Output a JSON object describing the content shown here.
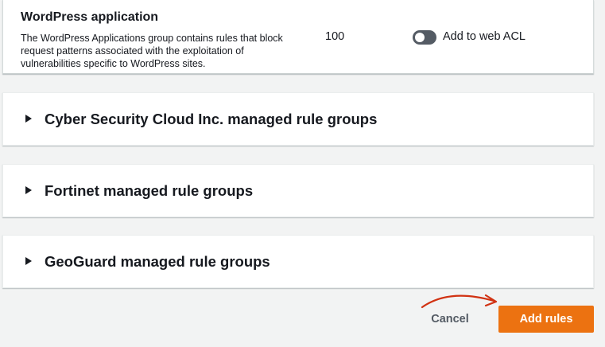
{
  "rule": {
    "name": "WordPress application",
    "description": "The WordPress Applications group contains rules that block request patterns associated with the exploitation of vulnerabilities specific to WordPress sites.",
    "capacity": "100",
    "toggle_label": "Add to web ACL",
    "toggle_on": false
  },
  "groups": [
    {
      "title": "Cyber Security Cloud Inc. managed rule groups"
    },
    {
      "title": "Fortinet managed rule groups"
    },
    {
      "title": "GeoGuard managed rule groups"
    }
  ],
  "footer": {
    "cancel_label": "Cancel",
    "add_label": "Add rules"
  },
  "colors": {
    "primary_button": "#ec7211",
    "annotation_arrow": "#d13212",
    "toggle_off": "#545b64"
  }
}
